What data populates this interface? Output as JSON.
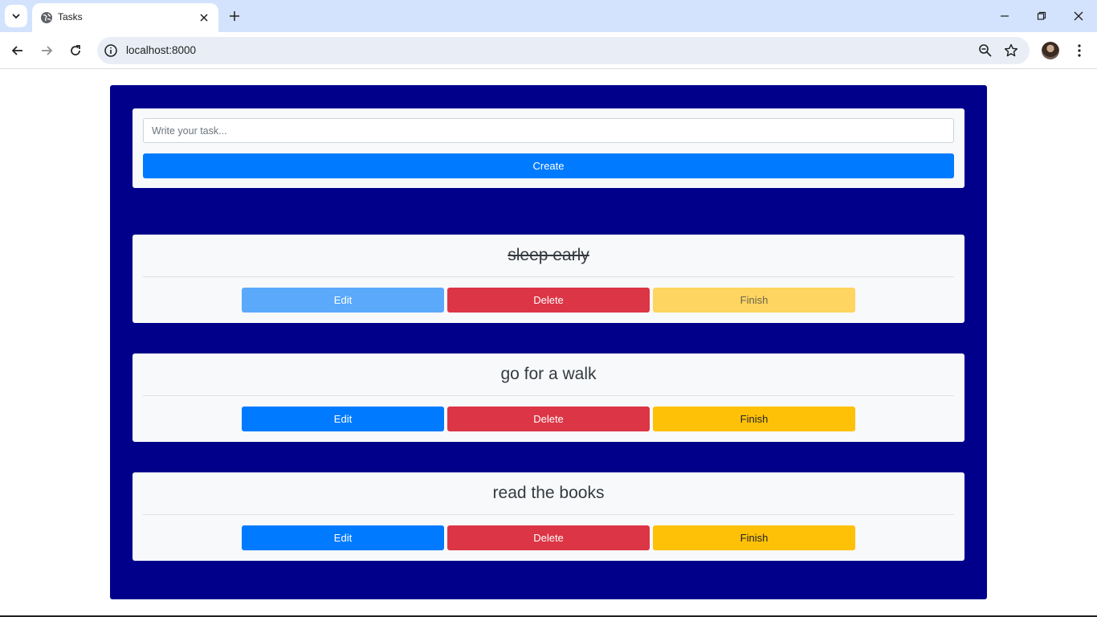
{
  "browser": {
    "tab_title": "Tasks",
    "url": "localhost:8000"
  },
  "form": {
    "input_placeholder": "Write your task...",
    "input_value": "",
    "create_label": "Create"
  },
  "tasks": [
    {
      "title": "sleep early",
      "finished": true,
      "edit_label": "Edit",
      "delete_label": "Delete",
      "finish_label": "Finish"
    },
    {
      "title": "go for a walk",
      "finished": false,
      "edit_label": "Edit",
      "delete_label": "Delete",
      "finish_label": "Finish"
    },
    {
      "title": "read the books",
      "finished": false,
      "edit_label": "Edit",
      "delete_label": "Delete",
      "finish_label": "Finish"
    }
  ],
  "colors": {
    "app_background": "#00008b",
    "primary": "#007bff",
    "danger": "#dc3545",
    "warning": "#ffc107"
  },
  "icons": [
    "tab-search-icon",
    "globe-icon",
    "close-icon",
    "plus-icon",
    "minimize-icon",
    "restore-icon",
    "back-icon",
    "forward-icon",
    "reload-icon",
    "info-icon",
    "zoom-icon",
    "star-icon",
    "menu-icon"
  ]
}
